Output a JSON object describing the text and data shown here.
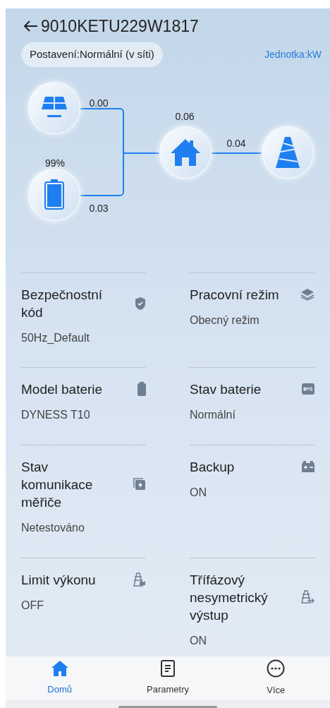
{
  "header": {
    "title": "9010KETU229W1817"
  },
  "status": {
    "chip": "Postavení:Normální (v síti)",
    "unit": "Jednotka:kW"
  },
  "flow": {
    "solar": {
      "reading": "0.00"
    },
    "battery": {
      "charge": "99%",
      "reading": "0.03"
    },
    "home": {
      "reading": "0.06"
    },
    "grid": {
      "reading": "0.04"
    }
  },
  "info": [
    {
      "label": "Bezpečnostní kód",
      "value": "50Hz_Default"
    },
    {
      "label": "Pracovní režim",
      "value": "Obecný režim"
    },
    {
      "label": "Model baterie",
      "value": "DYNESS T10"
    },
    {
      "label": "Stav baterie",
      "value": "Normální"
    },
    {
      "label": "Stav komunikace měřiče",
      "value": "Netestováno"
    },
    {
      "label": "Backup",
      "value": "ON"
    },
    {
      "label": "Limit výkonu",
      "value": "OFF"
    },
    {
      "label": "Třífázový nesymetrický výstup",
      "value": "ON"
    }
  ],
  "nav": [
    {
      "label": "Domů",
      "selected": true
    },
    {
      "label": "Parametry",
      "selected": false
    },
    {
      "label": "Více",
      "selected": false
    }
  ]
}
